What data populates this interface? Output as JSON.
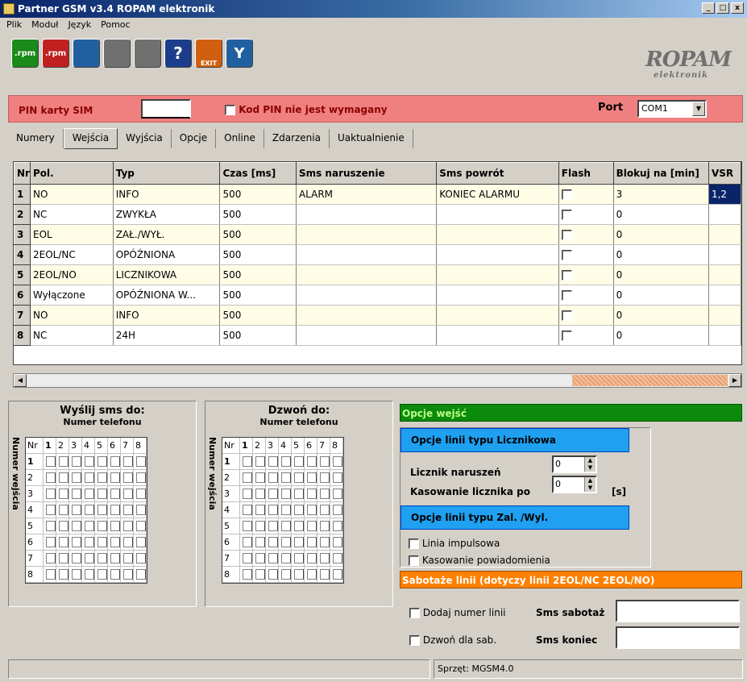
{
  "window": {
    "title": "Partner GSM v3.4 ROPAM elektronik",
    "min": "_",
    "max": "□",
    "close": "x"
  },
  "menu": [
    "Plik",
    "Moduł",
    "Język",
    "Pomoc"
  ],
  "toolbar": {
    "buttons": [
      {
        "icon": "upload-rpm-icon",
        "label": ".rpm",
        "color": "#1a8a1a"
      },
      {
        "icon": "download-rpm-icon",
        "label": ".rpm",
        "color": "#c02020"
      },
      {
        "icon": "connect-icon",
        "label": "",
        "color": "#2060a0"
      },
      {
        "icon": "read-module-icon",
        "label": "",
        "color": "#707070"
      },
      {
        "icon": "write-module-icon",
        "label": "",
        "color": "#707070"
      },
      {
        "icon": "help-icon",
        "label": "?",
        "color": "#1c3c8c"
      },
      {
        "icon": "exit-icon",
        "label": "EXIT",
        "color": "#d06010"
      },
      {
        "icon": "wireless-icon",
        "label": "Y",
        "color": "#2060a0"
      }
    ]
  },
  "logo": {
    "brand": "ROPAM",
    "sub": "elektronik"
  },
  "pin": {
    "label": "PIN karty SIM",
    "value": "",
    "not_required_label": "Kod PIN nie jest wymagany",
    "port_label": "Port",
    "port_value": "COM1",
    "color": "#f08080"
  },
  "tabs": [
    "Numery",
    "Wejścia",
    "Wyjścia",
    "Opcje",
    "Online",
    "Zdarzenia",
    "Uaktualnienie"
  ],
  "table": {
    "columns": [
      "Nr",
      "Pol.",
      "Typ",
      "Czas [ms]",
      "Sms naruszenie",
      "Sms powrót",
      "Flash",
      "Blokuj na [min]",
      "VSR"
    ],
    "rows": [
      [
        "1",
        "NO",
        "INFO",
        "500",
        "ALARM",
        "KONIEC ALARMU",
        "",
        "3",
        "1,2"
      ],
      [
        "2",
        "NC",
        "ZWYKŁA",
        "500",
        "",
        "",
        "",
        "0",
        ""
      ],
      [
        "3",
        "EOL",
        "ZAŁ./WYŁ.",
        "500",
        "",
        "",
        "",
        "0",
        ""
      ],
      [
        "4",
        "2EOL/NC",
        "OPÓŹNIONA",
        "500",
        "",
        "",
        "",
        "0",
        ""
      ],
      [
        "5",
        "2EOL/NO",
        "LICZNIKOWA",
        "500",
        "",
        "",
        "",
        "0",
        ""
      ],
      [
        "6",
        "Wyłączone",
        "OPÓŹNIONA W...",
        "500",
        "",
        "",
        "",
        "0",
        ""
      ],
      [
        "7",
        "NO",
        "INFO",
        "500",
        "",
        "",
        "",
        "0",
        ""
      ],
      [
        "8",
        "NC",
        "24H",
        "500",
        "",
        "",
        "",
        "0",
        ""
      ]
    ]
  },
  "sms_matrix": {
    "title": "Wyślij sms do:",
    "subtitle": "Numer telefonu",
    "side_label": "Numer wejścia",
    "nr_label": "Nr",
    "cols": [
      "1",
      "2",
      "3",
      "4",
      "5",
      "6",
      "7",
      "8"
    ],
    "rows": [
      "1",
      "2",
      "3",
      "4",
      "5",
      "6",
      "7",
      "8"
    ]
  },
  "call_matrix": {
    "title": "Dzwoń do:",
    "subtitle": "Numer telefonu",
    "side_label": "Numer wejścia",
    "nr_label": "Nr",
    "cols": [
      "1",
      "2",
      "3",
      "4",
      "5",
      "6",
      "7",
      "8"
    ],
    "rows": [
      "1",
      "2",
      "3",
      "4",
      "5",
      "6",
      "7",
      "8"
    ]
  },
  "options": {
    "header": "Opcje wejść",
    "counter_header": "Opcje linii typu Licznikowa",
    "counter_violations_label": "Licznik naruszeń",
    "counter_violations_value": "0",
    "counter_reset_label": "Kasowanie licznika po",
    "counter_reset_value": "0",
    "counter_reset_unit": "[s]",
    "onoff_header": "Opcje linii typu Zal. /Wyl.",
    "impulse_label": "Linia impulsowa",
    "reset_notify_label": "Kasowanie powiadomienia",
    "sabotage_header": "Sabotaże linii (dotyczy linii 2EOL/NC 2EOL/NO)",
    "add_line_label": "Dodaj numer linii",
    "sms_sabotage_label": "Sms sabotaż",
    "call_sab_label": "Dzwoń dla sab.",
    "sms_end_label": "Sms koniec",
    "colors": {
      "green": "#0b8a0b",
      "blue": "#1fa0f0",
      "orange": "#ff8000"
    }
  },
  "status": {
    "left": "",
    "hardware": "Sprzęt: MGSM4.0"
  }
}
